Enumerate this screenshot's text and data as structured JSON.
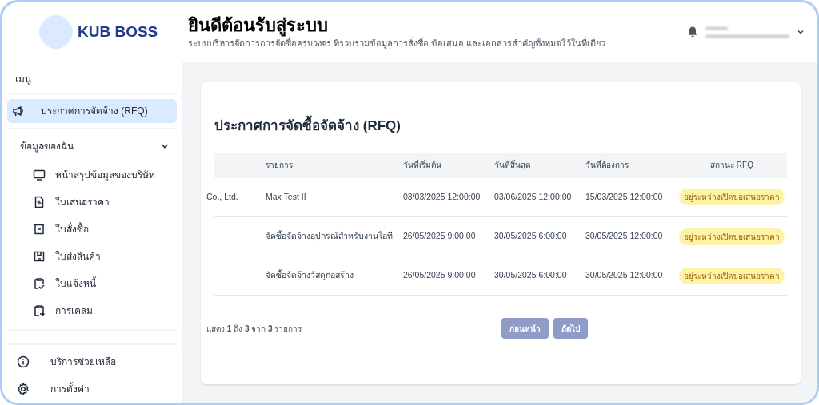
{
  "header": {
    "logo_text": "KUB BOSS",
    "title": "ยินดีต้อนรับสู่ระบบ",
    "subtitle": "ระบบบริหารจัดการการจัดซื้อครบวงจร ที่รวบรวมข้อมูลการสั่งซื้อ ข้อเสนอ และเอกสารสำคัญทั้งหมดไว้ในที่เดียว"
  },
  "sidebar": {
    "menu_label": "เมนู",
    "top_items": [
      {
        "label": "ประกาศการจัดจ้าง (RFQ)",
        "selected": true
      }
    ],
    "group": {
      "label": "ข้อมูลของฉัน",
      "expanded": true,
      "children": [
        {
          "label": "หน้าสรุปข้อมูลของบริษัท",
          "selected": false
        },
        {
          "label": "ใบเสนอราคา",
          "selected": false
        },
        {
          "label": "ใบสั่งซื้อ",
          "selected": false
        },
        {
          "label": "ใบส่งสินค้า",
          "selected": false
        },
        {
          "label": "ใบแจ้งหนี้",
          "selected": false
        },
        {
          "label": "การเคลม",
          "selected": false
        }
      ]
    },
    "bottom_items": [
      {
        "label": "บริการช่วยเหลือ",
        "selected": false
      },
      {
        "label": "การตั้งค่า",
        "selected": false
      }
    ]
  },
  "main": {
    "title": "ประกาศการจัดซื้อจัดจ้าง (RFQ)",
    "table": {
      "columns": [
        "รายการ",
        "วันที่เริ่มต้น",
        "วันที่สิ้นสุด",
        "วันที่ต้องการ",
        "สถานะ RFQ"
      ],
      "rows": [
        {
          "column_1": "Co., Ltd.",
          "item": "Max Test II",
          "start": "03/03/2025 12:00:00",
          "end": "03/06/2025 12:00:00",
          "need": "15/03/2025 12:00:00",
          "status": "อยู่ระหว่างเปิดขอเสนอราคา",
          "color": "#fdf3a7"
        },
        {
          "item": "จัดซื้อจัดจ้างอุปกรณ์สำหรับงานไอที",
          "start": "26/05/2025 9:00:00",
          "end": "30/05/2025 6:00:00",
          "need": "30/05/2025 12:00:00",
          "status": "อยู่ระหว่างเปิดขอเสนอราคา",
          "color": "#fdf3a7"
        },
        {
          "item": "จัดซื้อจัดจ้างวัสดุก่อสร้าง",
          "start": "26/05/2025 9:00:00",
          "end": "30/05/2025 6:00:00",
          "need": "30/05/2025 12:00:00",
          "status": "อยู่ระหว่างเปิดขอเสนอราคา",
          "color": "#fdf3a7"
        }
      ]
    },
    "summary": "แสดง **1** ถึง **3** จาก **3** รายการ",
    "buttons": [
      {
        "label": "ก่อนหน้า",
        "disabled": true
      },
      {
        "label": "ถัดไป",
        "disabled": true
      }
    ]
  }
}
